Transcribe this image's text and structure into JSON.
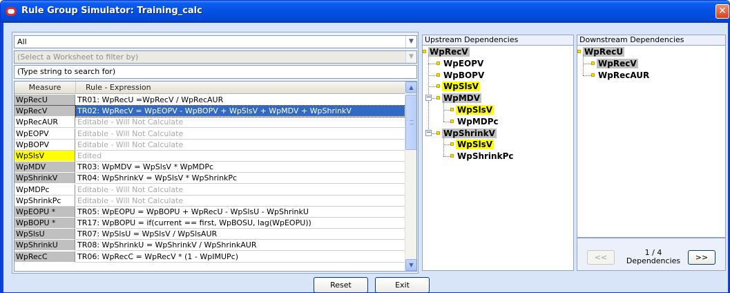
{
  "window": {
    "title": "Rule Group Simulator: Training_calc",
    "close_glyph": "✕"
  },
  "filters": {
    "rule_group": "All",
    "worksheet_placeholder": "(Select a Worksheet to filter by)",
    "search_placeholder": "(Type string to search for)"
  },
  "grid": {
    "headers": {
      "measure": "Measure",
      "expression": "Rule - Expression"
    },
    "rows": [
      {
        "measure": "WpRecU",
        "expression": "TR01:  WpRecU =WpRecV / WpRecAUR",
        "measure_style": "gray",
        "expr_style": "normal"
      },
      {
        "measure": "WpRecV",
        "expression": "TR02:  WpRecV = WpEOPV - WpBOPV + WpSlsV + WpMDV + WpShrinkV",
        "measure_style": "sel",
        "expr_style": "selected"
      },
      {
        "measure": "WpRecAUR",
        "expression": "Editable - Will Not Calculate",
        "measure_style": "white",
        "expr_style": "gray"
      },
      {
        "measure": "WpEOPV",
        "expression": "Editable - Will Not Calculate",
        "measure_style": "white",
        "expr_style": "gray"
      },
      {
        "measure": "WpBOPV",
        "expression": "Editable - Will Not Calculate",
        "measure_style": "white",
        "expr_style": "gray"
      },
      {
        "measure": "WpSlsV",
        "expression": "Edited",
        "measure_style": "yellow",
        "expr_style": "gray"
      },
      {
        "measure": "WpMDV",
        "expression": "TR03:  WpMDV = WpSlsV * WpMDPc",
        "measure_style": "gray",
        "expr_style": "normal"
      },
      {
        "measure": "WpShrinkV",
        "expression": "TR04:  WpShrinkV = WpSlsV * WpShrinkPc",
        "measure_style": "gray",
        "expr_style": "normal"
      },
      {
        "measure": "WpMDPc",
        "expression": "Editable - Will Not Calculate",
        "measure_style": "white",
        "expr_style": "gray"
      },
      {
        "measure": "WpShrinkPc",
        "expression": "Editable - Will Not Calculate",
        "measure_style": "white",
        "expr_style": "gray"
      },
      {
        "measure": "WpEOPU *",
        "expression": "TR05:  WpEOPU = WpBOPU + WpRecU - WpSlsU - WpShrinkU",
        "measure_style": "gray",
        "expr_style": "normal"
      },
      {
        "measure": "WpBOPU *",
        "expression": "TR17:  WpBOPU = if(current == first, WpBOSU, lag(WpEOPU))",
        "measure_style": "gray",
        "expr_style": "normal"
      },
      {
        "measure": "WpSlsU",
        "expression": "TR07:  WpSlsU = WpSlsV / WpSlsAUR",
        "measure_style": "gray",
        "expr_style": "normal"
      },
      {
        "measure": "WpShrinkU",
        "expression": "TR08:  WpShrinkU = WpShrinkV / WpShrinkAUR",
        "measure_style": "gray",
        "expr_style": "normal"
      },
      {
        "measure": "WpRecC",
        "expression": "TR06:  WpRecC = WpRecV * (1 - WpIMUPc)",
        "measure_style": "gray",
        "expr_style": "normal"
      }
    ]
  },
  "upstream": {
    "title": "Upstream Dependencies",
    "nodes": [
      {
        "label": "WpRecV",
        "highlight": "gray"
      },
      {
        "label": "WpEOPV",
        "highlight": "none"
      },
      {
        "label": "WpBOPV",
        "highlight": "none"
      },
      {
        "label": "WpSlsV",
        "highlight": "yellow"
      },
      {
        "label": "WpMDV",
        "highlight": "gray"
      },
      {
        "label": "WpSlsV",
        "highlight": "yellow"
      },
      {
        "label": "WpMDPc",
        "highlight": "none"
      },
      {
        "label": "WpShrinkV",
        "highlight": "gray"
      },
      {
        "label": "WpSlsV",
        "highlight": "yellow"
      },
      {
        "label": "WpShrinkPc",
        "highlight": "none"
      }
    ],
    "expander_glyph": "−"
  },
  "downstream": {
    "title": "Downstream Dependencies",
    "nodes": [
      {
        "label": "WpRecU",
        "highlight": "gray"
      },
      {
        "label": "WpRecV",
        "highlight": "gray"
      },
      {
        "label": "WpRecAUR",
        "highlight": "none"
      }
    ]
  },
  "pager": {
    "prev_label": "<<",
    "next_label": ">>",
    "page": "1 / 4",
    "caption": "Dependencies"
  },
  "buttons": {
    "reset": "Reset",
    "exit": "Exit"
  },
  "icons": {
    "combo_arrow": "chevron-down-icon",
    "scroll_up": "chevron-up-icon",
    "scroll_down": "chevron-down-icon"
  },
  "colors": {
    "title_bar": "#0450e0",
    "selection": "#316ac5",
    "edited_highlight": "#ffff00",
    "measure_gray": "#c0c0c0"
  }
}
